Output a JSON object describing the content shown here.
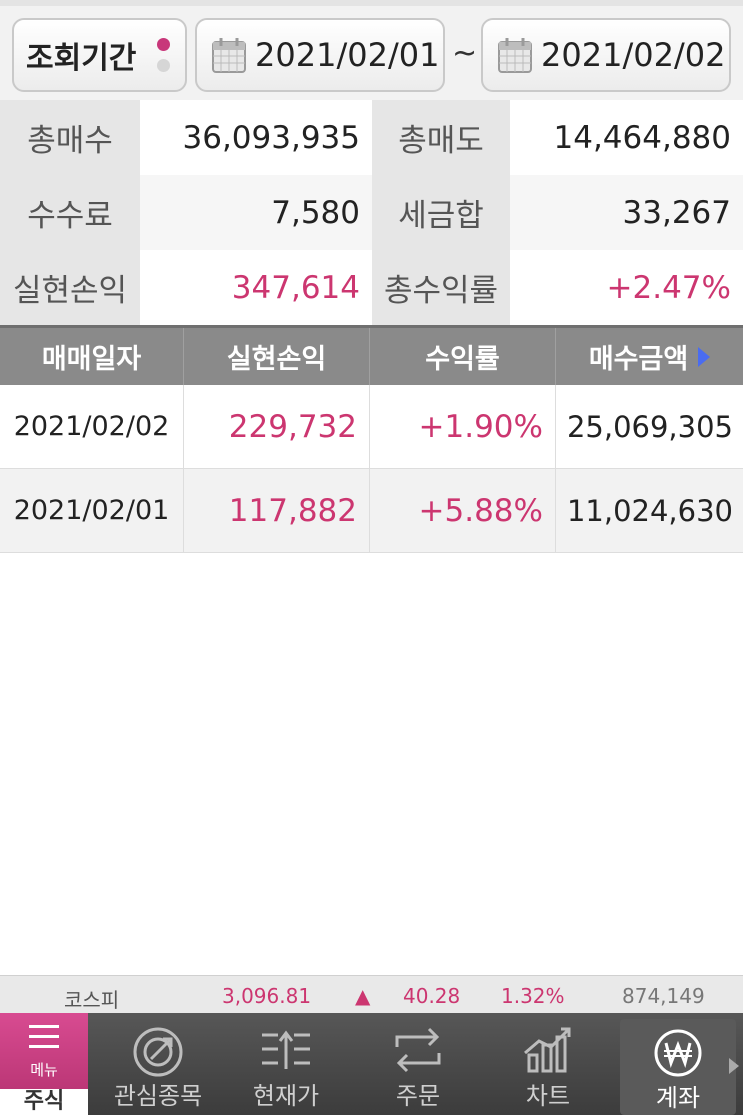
{
  "period": {
    "label": "조회기간",
    "start_date": "2021/02/01",
    "separator": "~",
    "end_date": "2021/02/02"
  },
  "summary": [
    {
      "label1": "총매수",
      "value1": "36,093,935",
      "label2": "총매도",
      "value2": "14,464,880"
    },
    {
      "label1": "수수료",
      "value1": "7,580",
      "label2": "세금합",
      "value2": "33,267"
    },
    {
      "label1": "실현손익",
      "value1": "347,614",
      "label2": "총수익률",
      "value2": "+2.47%"
    }
  ],
  "table": {
    "headers": [
      "매매일자",
      "실현손익",
      "수익률",
      "매수금액"
    ],
    "rows": [
      [
        "2021/02/02",
        "229,732",
        "+1.90%",
        "25,069,305"
      ],
      [
        "2021/02/01",
        "117,882",
        "+5.88%",
        "11,024,630"
      ]
    ]
  },
  "ticker": {
    "name": "코스피",
    "index": "3,096.81",
    "direction": "▲",
    "change": "40.28",
    "percent": "1.32%",
    "volume": "874,149"
  },
  "nav": {
    "menu": "메뉴",
    "stock": "주식",
    "items": [
      "관심종목",
      "현재가",
      "주문",
      "차트",
      "계좌"
    ]
  },
  "colors": {
    "positive": "#cc3670",
    "accent": "#c8377a",
    "header_bg": "#8a8a8a"
  },
  "icons": [
    "calendar-icon",
    "hamburger-icon",
    "watchlist-icon",
    "current-price-icon",
    "order-icon",
    "chart-icon",
    "won-icon"
  ]
}
